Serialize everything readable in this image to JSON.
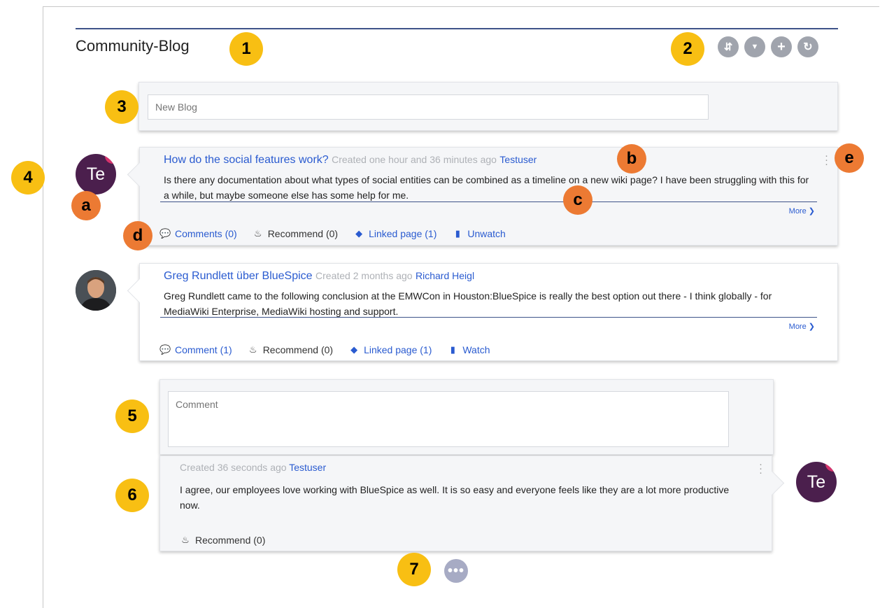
{
  "page": {
    "title": "Community-Blog"
  },
  "toolbar": {
    "buttons": [
      {
        "name": "sort-button",
        "icon": "sort-icon",
        "glyph": "⇵"
      },
      {
        "name": "filter-button",
        "icon": "filter-icon",
        "glyph": "▼"
      },
      {
        "name": "add-button",
        "icon": "plus-icon",
        "glyph": "+"
      },
      {
        "name": "refresh-button",
        "icon": "refresh-icon",
        "glyph": "↻"
      }
    ]
  },
  "new_blog": {
    "placeholder": "New Blog"
  },
  "posts": [
    {
      "title": "How do the social features work?",
      "created": "Created one hour and 36 minutes ago",
      "author": "Testuser",
      "avatar_text": "Te",
      "body": "Is there any documentation about what types of social entities can be combined as a timeline on a new wiki page? I have been struggling with this for a while, but maybe someone else has some help for me.",
      "more": "More ❯",
      "comments": "Comments (0)",
      "recommend": "Recommend (0)",
      "linked": "Linked page (1)",
      "watch": "Unwatch"
    },
    {
      "title": "Greg Rundlett über BlueSpice",
      "created": "Created 2 months ago",
      "author": "Richard Heigl",
      "body": "Greg Rundlett came to the following conclusion at the EMWCon in Houston:BlueSpice is really the best option out there - I think globally - for MediaWiki Enterprise, MediaWiki hosting and support.",
      "more": "More ❯",
      "comments": "Comment (1)",
      "recommend": "Recommend (0)",
      "linked": "Linked page (1)",
      "watch": "Watch"
    }
  ],
  "comment_form": {
    "placeholder": "Comment"
  },
  "comment": {
    "created": "Created 36 seconds ago",
    "author": "Testuser",
    "avatar_text": "Te",
    "body": "I agree, our employees love working with BlueSpice as well. It is so easy and everyone feels like they are a lot more productive now.",
    "recommend": "Recommend (0)"
  },
  "load_more": {
    "label": "•••"
  },
  "callouts": {
    "numbers": [
      "1",
      "2",
      "3",
      "4",
      "5",
      "6",
      "7"
    ],
    "letters": [
      "a",
      "b",
      "c",
      "d",
      "e"
    ]
  },
  "colors": {
    "accent": "#2a5bd0",
    "rule": "#3e5389",
    "badge_number": "#f8bf13",
    "badge_letter": "#ec7a33",
    "avatar": "#4b1f4d"
  }
}
